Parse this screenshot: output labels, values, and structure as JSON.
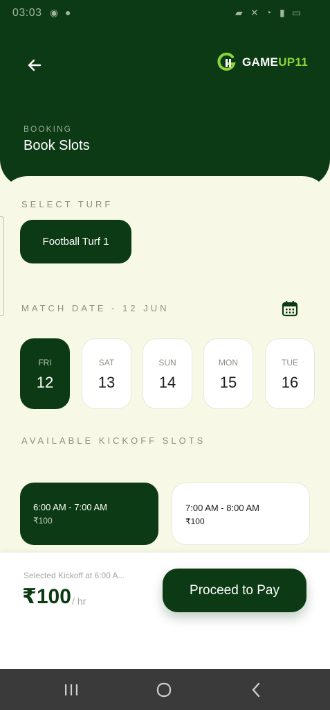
{
  "status": {
    "time": "03:03"
  },
  "header": {
    "logo_a": "GAME",
    "logo_b": "UP11",
    "eyebrow": "BOOKING",
    "title": "Book Slots"
  },
  "turf_section": {
    "label": "SELECT TURF",
    "selected_turf": "Football Turf 1"
  },
  "date_section": {
    "label": "MATCH DATE - 12 JUN",
    "dates": [
      {
        "dow": "FRI",
        "day": "12"
      },
      {
        "dow": "SAT",
        "day": "13"
      },
      {
        "dow": "SUN",
        "day": "14"
      },
      {
        "dow": "MON",
        "day": "15"
      },
      {
        "dow": "TUE",
        "day": "16"
      }
    ]
  },
  "slots_section": {
    "label": "AVAILABLE KICKOFF SLOTS",
    "slots": [
      {
        "time": "6:00 AM - 7:00 AM",
        "price": "₹100"
      },
      {
        "time": "7:00 AM - 8:00 AM",
        "price": "₹100"
      }
    ]
  },
  "footer": {
    "caption": "Selected Kickoff at 6:00 A...",
    "price": "₹100",
    "unit": "/ hr",
    "pay_label": "Proceed to Pay"
  },
  "colors": {
    "primary": "#0c3a14",
    "accent": "#8ad63a",
    "background": "#f7f9e6"
  }
}
